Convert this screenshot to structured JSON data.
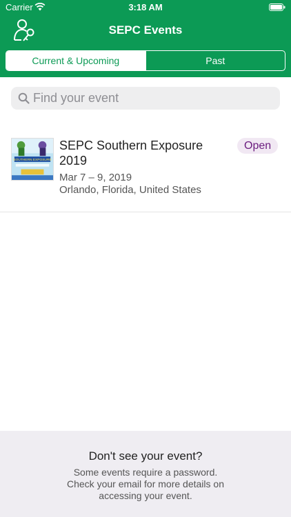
{
  "status_bar": {
    "carrier": "Carrier",
    "time": "3:18 AM"
  },
  "header": {
    "title": "SEPC Events",
    "icon": "user-key-icon",
    "background_color": "#0c9a55"
  },
  "tabs": [
    {
      "label": "Current & Upcoming",
      "active": true
    },
    {
      "label": "Past",
      "active": false
    }
  ],
  "search": {
    "placeholder": "Find your event",
    "value": ""
  },
  "events": [
    {
      "title": "SEPC Southern Exposure 2019",
      "dates": "Mar 7 – 9, 2019",
      "location": "Orlando, Florida, United States",
      "status": "Open",
      "thumbnail_caption": "SOUTHERN EXPOSURE"
    }
  ],
  "footer": {
    "title": "Don't see your event?",
    "text": "Some events require a password. Check your email for more details on accessing your event."
  },
  "colors": {
    "accent": "#0c9a55",
    "badge_bg": "#f1e8f3",
    "badge_text": "#6a1b7e"
  }
}
